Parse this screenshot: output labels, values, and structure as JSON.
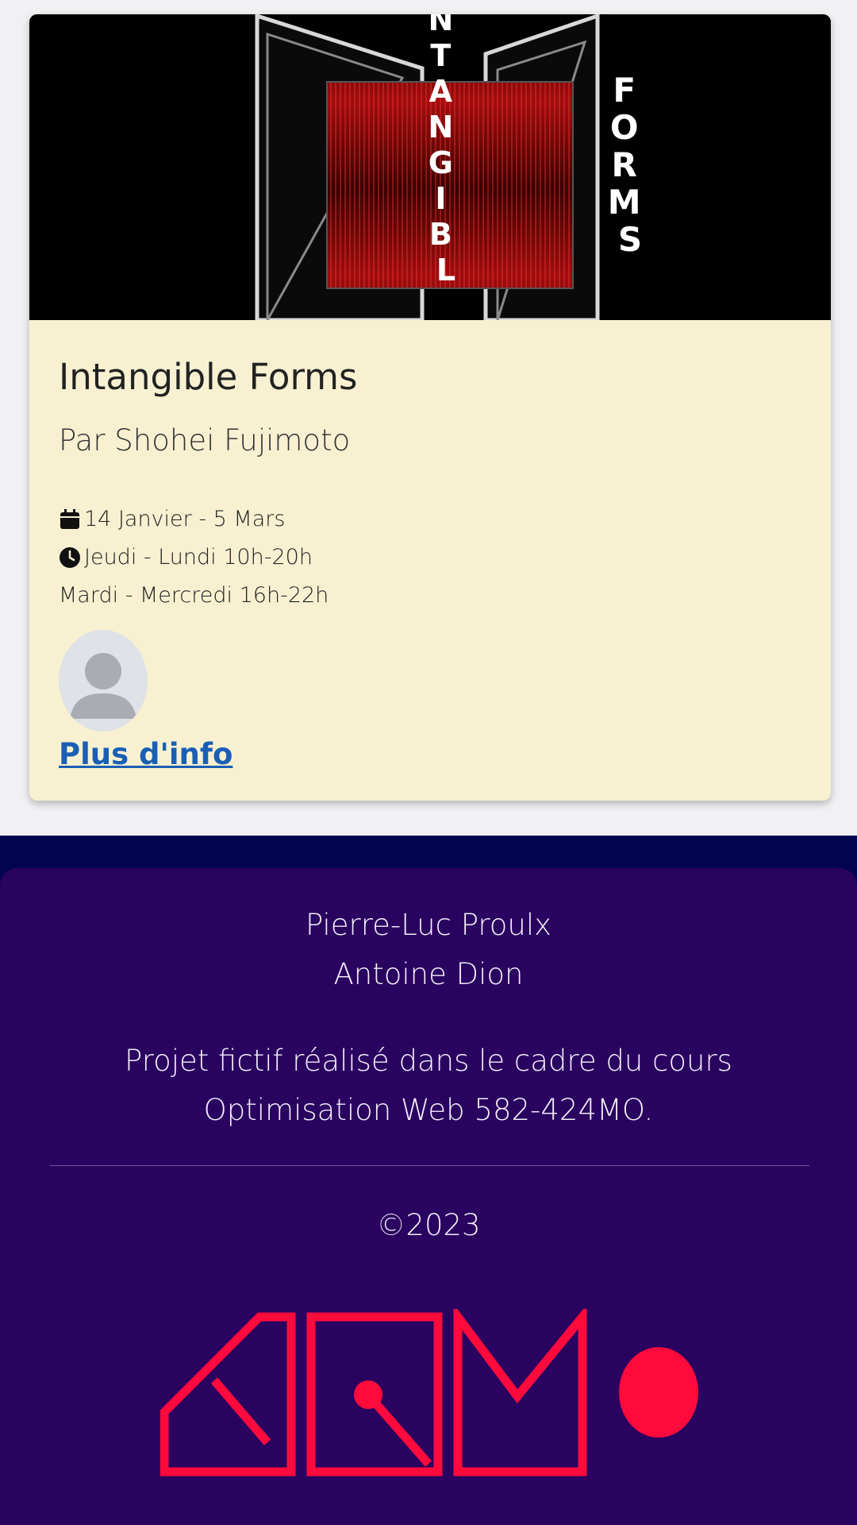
{
  "event_card": {
    "poster": {
      "vertical_word_1": "NTANGIBL",
      "vertical_word_2": "FORMS"
    },
    "title": "Intangible Forms",
    "author": "Par Shohei Fujimoto",
    "dates": "14 Janvier - 5 Mars",
    "hours_1": "Jeudi - Lundi 10h-20h",
    "hours_2": "Mardi - Mercredi 16h-22h",
    "more_link": "Plus d'info",
    "icons": [
      "calendar-icon",
      "clock-icon",
      "avatar-placeholder-icon"
    ]
  },
  "footer": {
    "authors": [
      "Pierre-Luc Proulx",
      "Antoine Dion"
    ],
    "description_line_1": "Projet fictif réalisé dans le cadre du cours",
    "description_line_2": "Optimisation Web 582-424MO.",
    "copyright": "©2023",
    "logo_color": "#ff0a3c"
  },
  "colors": {
    "card_background": "#f7f1d2",
    "footer_background": "#2a0260",
    "footer_band": "#03044f",
    "link": "#1a5fb4"
  }
}
